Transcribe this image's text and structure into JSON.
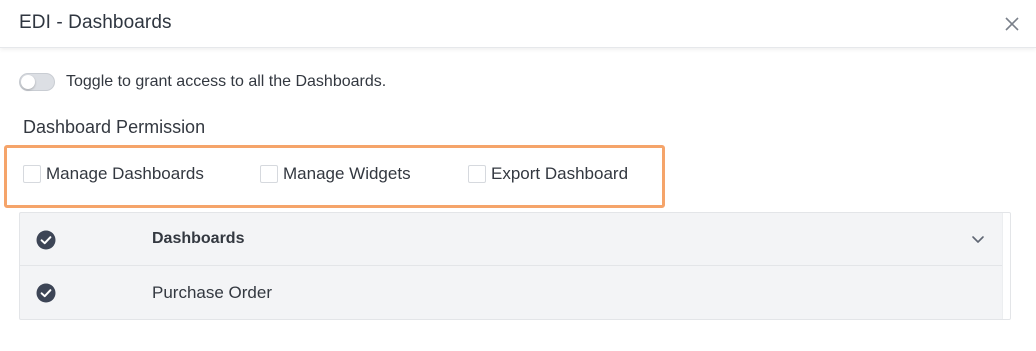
{
  "modal": {
    "title": "EDI - Dashboards"
  },
  "toggle": {
    "label": "Toggle to grant access to all the Dashboards.",
    "checked": false
  },
  "permissions": {
    "section_title": "Dashboard Permission",
    "highlight_color": "#f5a46a",
    "items": [
      {
        "label": "Manage Dashboards",
        "checked": false
      },
      {
        "label": "Manage Widgets",
        "checked": false
      },
      {
        "label": "Export Dashboard",
        "checked": false
      }
    ]
  },
  "table": {
    "rows": [
      {
        "label": "Dashboards",
        "selected": true,
        "expandable": true
      },
      {
        "label": "Purchase Order",
        "selected": true,
        "expandable": false
      }
    ]
  },
  "icons": {
    "close": "close-icon",
    "check": "check-circle-icon",
    "chevron": "chevron-down-icon"
  },
  "colors": {
    "check_fill": "#3d4556"
  }
}
